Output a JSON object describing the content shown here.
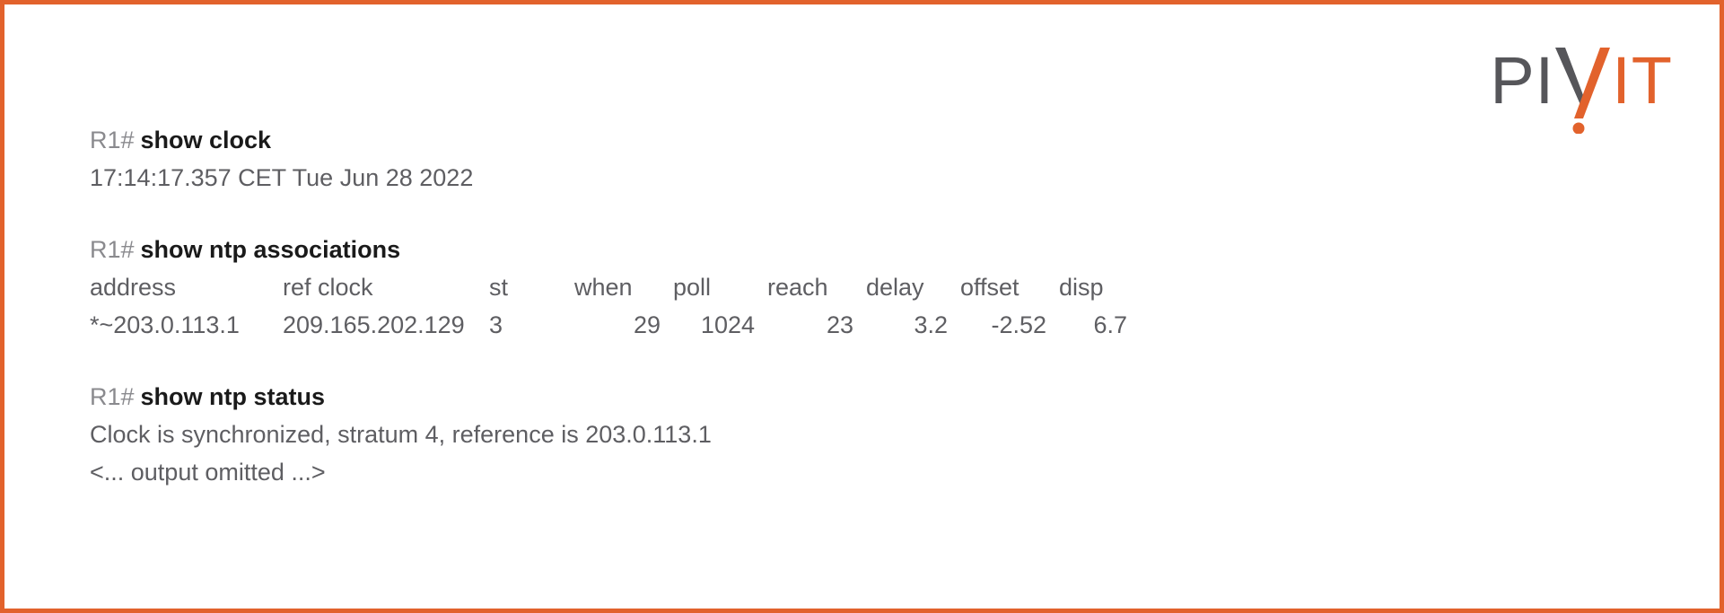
{
  "brand": {
    "logo_part_1": "PI",
    "logo_part_2": "IT",
    "dark_color": "#56565A",
    "accent_color": "#E2622C",
    "border_color": "#E2622C"
  },
  "blocks": [
    {
      "prompt": "R1#",
      "command": "show clock",
      "output_lines": [
        "17:14:17.357 CET Tue Jun 28 2022"
      ]
    },
    {
      "prompt": "R1#",
      "command": "show ntp associations",
      "table": {
        "headers": [
          "address",
          "ref clock",
          "st",
          "when",
          "poll",
          "reach",
          "delay",
          "offset",
          "disp"
        ],
        "rows": [
          [
            "*~203.0.113.1",
            "209.165.202.129",
            "3",
            "29",
            "1024",
            "23",
            "3.2",
            "-2.52",
            "6.7"
          ]
        ]
      }
    },
    {
      "prompt": "R1#",
      "command": "show ntp status",
      "output_lines": [
        "Clock is synchronized, stratum 4, reference is 203.0.113.1",
        "<... output omitted ...>"
      ]
    }
  ]
}
